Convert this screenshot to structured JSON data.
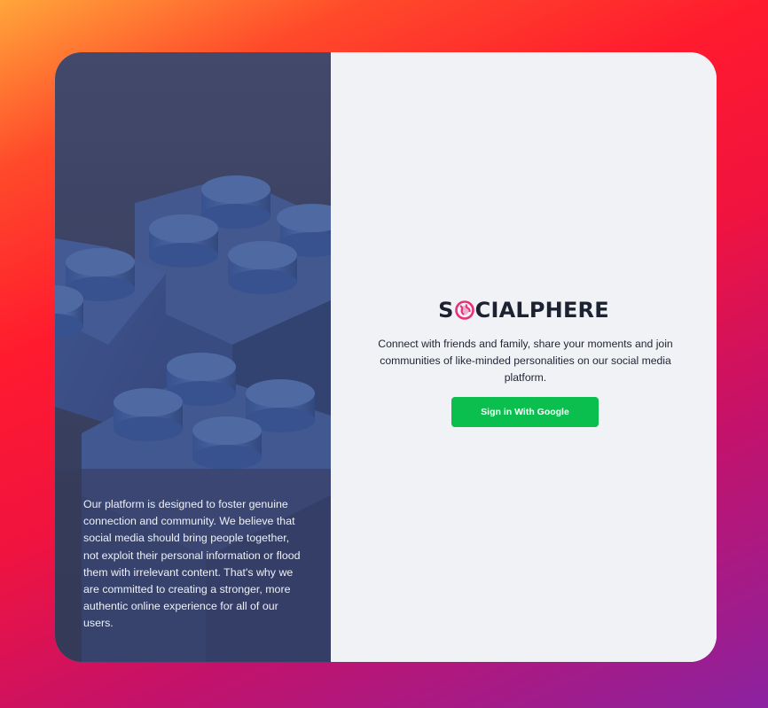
{
  "app": {
    "brand_part1": "S",
    "brand_part2": "CIALPHERE",
    "brand_icon": "globe-icon",
    "accent_color": "#e8317a"
  },
  "hero": {
    "image": "blue-toy-building-bricks",
    "description": "Our platform is designed to foster genuine connection and community. We believe that social media should bring people together, not exploit their personal information or flood them with irrelevant content. That's why we are committed to creating a stronger, more authentic online experience for all of our users."
  },
  "auth": {
    "tagline": "Connect with friends and family, share your moments and join communities of like-minded personalities on our social media platform.",
    "google_button_label": "Sign in With Google",
    "button_color": "#0bbf4f"
  }
}
